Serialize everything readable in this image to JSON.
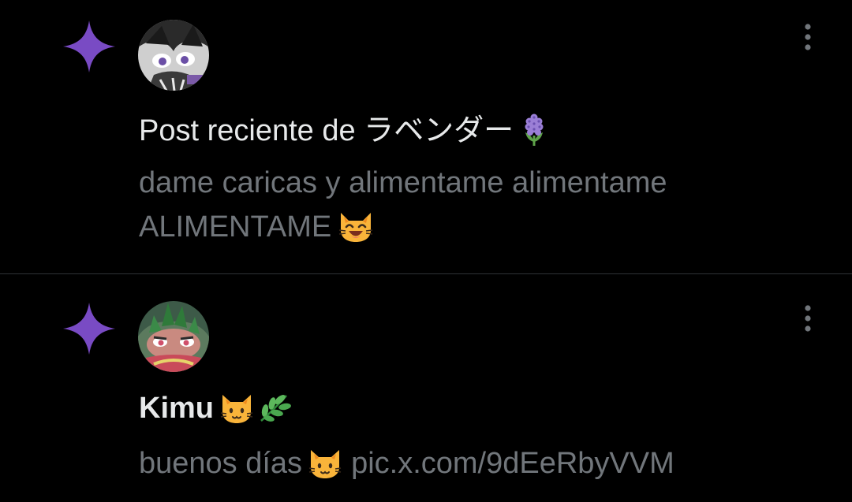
{
  "colors": {
    "background": "#000000",
    "accent_sparkle": "#794bc4",
    "primary_text": "#e7e9ea",
    "secondary_text": "#71767b",
    "divider": "#2f3336"
  },
  "notifications": [
    {
      "icon": "sparkle-icon",
      "avatar": "avatar-lavender",
      "headline": "Post reciente de ラベンダー",
      "headline_emoji": "hyacinth-emoji",
      "body_line1": "dame caricas y alimentame alimentame",
      "body_line2": "ALIMENTAME",
      "body_emoji": "smiling-cat-emoji",
      "more_icon": "more-vertical-icon"
    },
    {
      "icon": "sparkle-icon",
      "avatar": "avatar-kimu",
      "headline": "Kimu",
      "headline_emojis": [
        "cat-face-emoji",
        "herb-emoji"
      ],
      "body_text": "buenos días",
      "body_emoji": "cat-face-emoji",
      "body_link": "pic.x.com/9dEeRbyVVM",
      "more_icon": "more-vertical-icon"
    }
  ]
}
